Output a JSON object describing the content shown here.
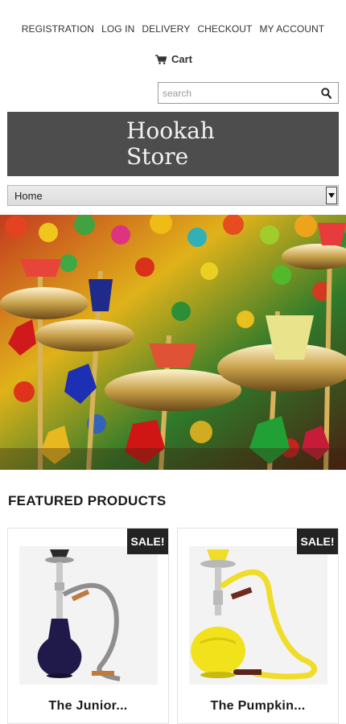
{
  "nav": {
    "links": [
      "REGISTRATION",
      "LOG IN",
      "DELIVERY",
      "CHECKOUT",
      "MY ACCOUNT"
    ]
  },
  "cart": {
    "label": "Cart",
    "icon": "cart-icon"
  },
  "search": {
    "placeholder": "search",
    "icon": "search-icon"
  },
  "logo": {
    "line1": "Hookah",
    "line2": "Store",
    "bg_color": "#4d4d4d"
  },
  "menu": {
    "selected": "Home"
  },
  "hero": {
    "alt": "Colorful hookahs"
  },
  "featured": {
    "title": "FEATURED PRODUCTS",
    "products": [
      {
        "name": "The Junior...",
        "badge": "SALE!",
        "base_color": "#1f1a4a"
      },
      {
        "name": "The Pumpkin...",
        "badge": "SALE!",
        "base_color": "#f1e21c"
      }
    ]
  }
}
